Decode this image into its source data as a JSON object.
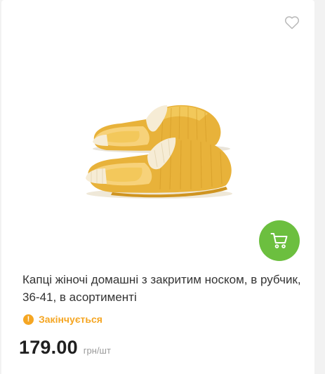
{
  "product": {
    "title": "Капці жіночі домашні з закритим носком, в рубчик, 36-41, в асортименті",
    "status": "Закінчується",
    "price": "179.00",
    "price_unit": "грн/шт"
  },
  "icons": {
    "favorite": "heart-outline-icon",
    "cart": "cart-icon",
    "status": "exclamation-circle-icon"
  },
  "colors": {
    "cart_button": "#6cbf3f",
    "status": "#f5a623",
    "price": "#1f1f1f",
    "slipper_yellow": "#e8b23a",
    "slipper_cream": "#f6ecd5"
  }
}
